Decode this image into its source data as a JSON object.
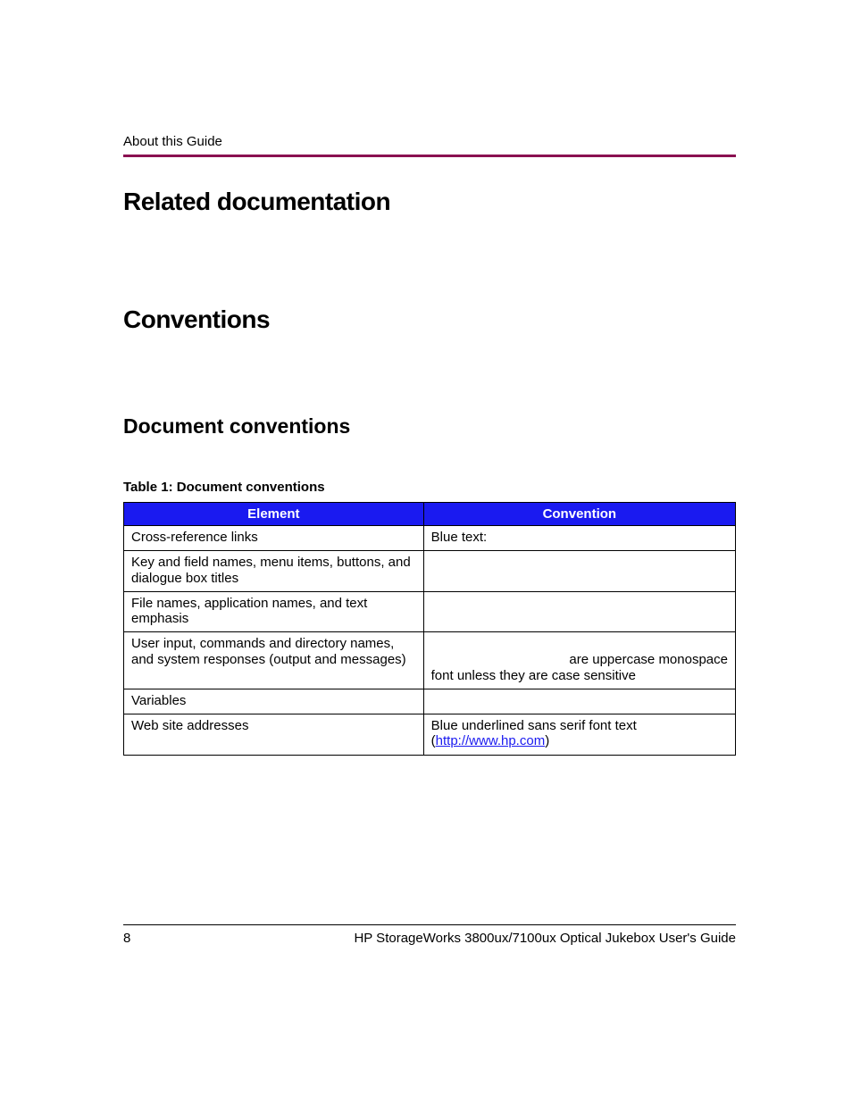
{
  "header": {
    "section_label": "About this Guide"
  },
  "sections": {
    "related_docs_title": "Related documentation",
    "conventions_title": "Conventions",
    "doc_conventions_title": "Document conventions"
  },
  "table": {
    "caption": "Table 1:  Document conventions",
    "headers": {
      "element": "Element",
      "convention": "Convention"
    },
    "rows": [
      {
        "element": "Cross-reference links",
        "convention": "Blue text:"
      },
      {
        "element": "Key and field names, menu items, buttons, and dialogue box titles",
        "convention": ""
      },
      {
        "element": "File names, application names, and text emphasis",
        "convention": ""
      },
      {
        "element": "User input, commands and directory names, and system responses (output and messages)",
        "convention_line1": "are uppercase monospace",
        "convention_line2": "font unless they are case sensitive"
      },
      {
        "element": "Variables",
        "convention": ""
      },
      {
        "element": "Web site addresses",
        "convention_prefix": "Blue underlined sans serif font text (",
        "convention_link": "http://www.hp.com",
        "convention_suffix": ")"
      }
    ]
  },
  "footer": {
    "page_number": "8",
    "doc_title": "HP StorageWorks 3800ux/7100ux Optical Jukebox User's Guide"
  }
}
